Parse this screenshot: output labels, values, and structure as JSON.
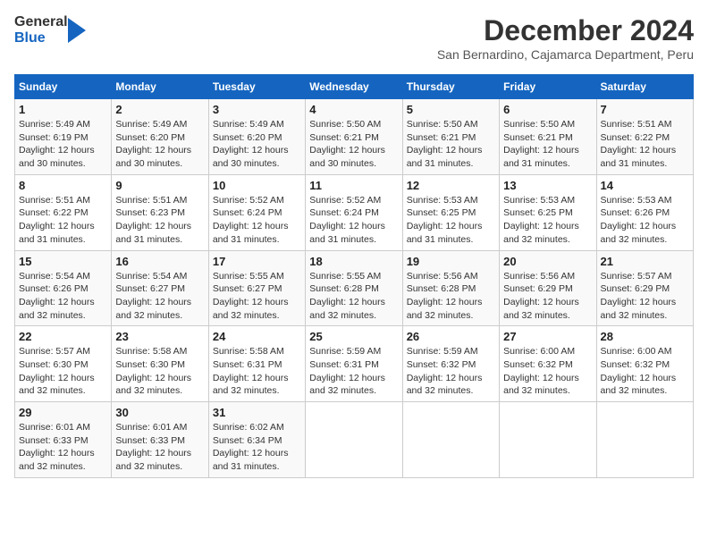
{
  "header": {
    "logo_line1": "General",
    "logo_line2": "Blue",
    "title": "December 2024",
    "subtitle": "San Bernardino, Cajamarca Department, Peru"
  },
  "columns": [
    "Sunday",
    "Monday",
    "Tuesday",
    "Wednesday",
    "Thursday",
    "Friday",
    "Saturday"
  ],
  "weeks": [
    [
      {
        "day": "1",
        "info": "Sunrise: 5:49 AM\nSunset: 6:19 PM\nDaylight: 12 hours\nand 30 minutes."
      },
      {
        "day": "2",
        "info": "Sunrise: 5:49 AM\nSunset: 6:20 PM\nDaylight: 12 hours\nand 30 minutes."
      },
      {
        "day": "3",
        "info": "Sunrise: 5:49 AM\nSunset: 6:20 PM\nDaylight: 12 hours\nand 30 minutes."
      },
      {
        "day": "4",
        "info": "Sunrise: 5:50 AM\nSunset: 6:21 PM\nDaylight: 12 hours\nand 30 minutes."
      },
      {
        "day": "5",
        "info": "Sunrise: 5:50 AM\nSunset: 6:21 PM\nDaylight: 12 hours\nand 31 minutes."
      },
      {
        "day": "6",
        "info": "Sunrise: 5:50 AM\nSunset: 6:21 PM\nDaylight: 12 hours\nand 31 minutes."
      },
      {
        "day": "7",
        "info": "Sunrise: 5:51 AM\nSunset: 6:22 PM\nDaylight: 12 hours\nand 31 minutes."
      }
    ],
    [
      {
        "day": "8",
        "info": "Sunrise: 5:51 AM\nSunset: 6:22 PM\nDaylight: 12 hours\nand 31 minutes."
      },
      {
        "day": "9",
        "info": "Sunrise: 5:51 AM\nSunset: 6:23 PM\nDaylight: 12 hours\nand 31 minutes."
      },
      {
        "day": "10",
        "info": "Sunrise: 5:52 AM\nSunset: 6:24 PM\nDaylight: 12 hours\nand 31 minutes."
      },
      {
        "day": "11",
        "info": "Sunrise: 5:52 AM\nSunset: 6:24 PM\nDaylight: 12 hours\nand 31 minutes."
      },
      {
        "day": "12",
        "info": "Sunrise: 5:53 AM\nSunset: 6:25 PM\nDaylight: 12 hours\nand 31 minutes."
      },
      {
        "day": "13",
        "info": "Sunrise: 5:53 AM\nSunset: 6:25 PM\nDaylight: 12 hours\nand 32 minutes."
      },
      {
        "day": "14",
        "info": "Sunrise: 5:53 AM\nSunset: 6:26 PM\nDaylight: 12 hours\nand 32 minutes."
      }
    ],
    [
      {
        "day": "15",
        "info": "Sunrise: 5:54 AM\nSunset: 6:26 PM\nDaylight: 12 hours\nand 32 minutes."
      },
      {
        "day": "16",
        "info": "Sunrise: 5:54 AM\nSunset: 6:27 PM\nDaylight: 12 hours\nand 32 minutes."
      },
      {
        "day": "17",
        "info": "Sunrise: 5:55 AM\nSunset: 6:27 PM\nDaylight: 12 hours\nand 32 minutes."
      },
      {
        "day": "18",
        "info": "Sunrise: 5:55 AM\nSunset: 6:28 PM\nDaylight: 12 hours\nand 32 minutes."
      },
      {
        "day": "19",
        "info": "Sunrise: 5:56 AM\nSunset: 6:28 PM\nDaylight: 12 hours\nand 32 minutes."
      },
      {
        "day": "20",
        "info": "Sunrise: 5:56 AM\nSunset: 6:29 PM\nDaylight: 12 hours\nand 32 minutes."
      },
      {
        "day": "21",
        "info": "Sunrise: 5:57 AM\nSunset: 6:29 PM\nDaylight: 12 hours\nand 32 minutes."
      }
    ],
    [
      {
        "day": "22",
        "info": "Sunrise: 5:57 AM\nSunset: 6:30 PM\nDaylight: 12 hours\nand 32 minutes."
      },
      {
        "day": "23",
        "info": "Sunrise: 5:58 AM\nSunset: 6:30 PM\nDaylight: 12 hours\nand 32 minutes."
      },
      {
        "day": "24",
        "info": "Sunrise: 5:58 AM\nSunset: 6:31 PM\nDaylight: 12 hours\nand 32 minutes."
      },
      {
        "day": "25",
        "info": "Sunrise: 5:59 AM\nSunset: 6:31 PM\nDaylight: 12 hours\nand 32 minutes."
      },
      {
        "day": "26",
        "info": "Sunrise: 5:59 AM\nSunset: 6:32 PM\nDaylight: 12 hours\nand 32 minutes."
      },
      {
        "day": "27",
        "info": "Sunrise: 6:00 AM\nSunset: 6:32 PM\nDaylight: 12 hours\nand 32 minutes."
      },
      {
        "day": "28",
        "info": "Sunrise: 6:00 AM\nSunset: 6:32 PM\nDaylight: 12 hours\nand 32 minutes."
      }
    ],
    [
      {
        "day": "29",
        "info": "Sunrise: 6:01 AM\nSunset: 6:33 PM\nDaylight: 12 hours\nand 32 minutes."
      },
      {
        "day": "30",
        "info": "Sunrise: 6:01 AM\nSunset: 6:33 PM\nDaylight: 12 hours\nand 32 minutes."
      },
      {
        "day": "31",
        "info": "Sunrise: 6:02 AM\nSunset: 6:34 PM\nDaylight: 12 hours\nand 31 minutes."
      },
      {
        "day": "",
        "info": ""
      },
      {
        "day": "",
        "info": ""
      },
      {
        "day": "",
        "info": ""
      },
      {
        "day": "",
        "info": ""
      }
    ]
  ]
}
